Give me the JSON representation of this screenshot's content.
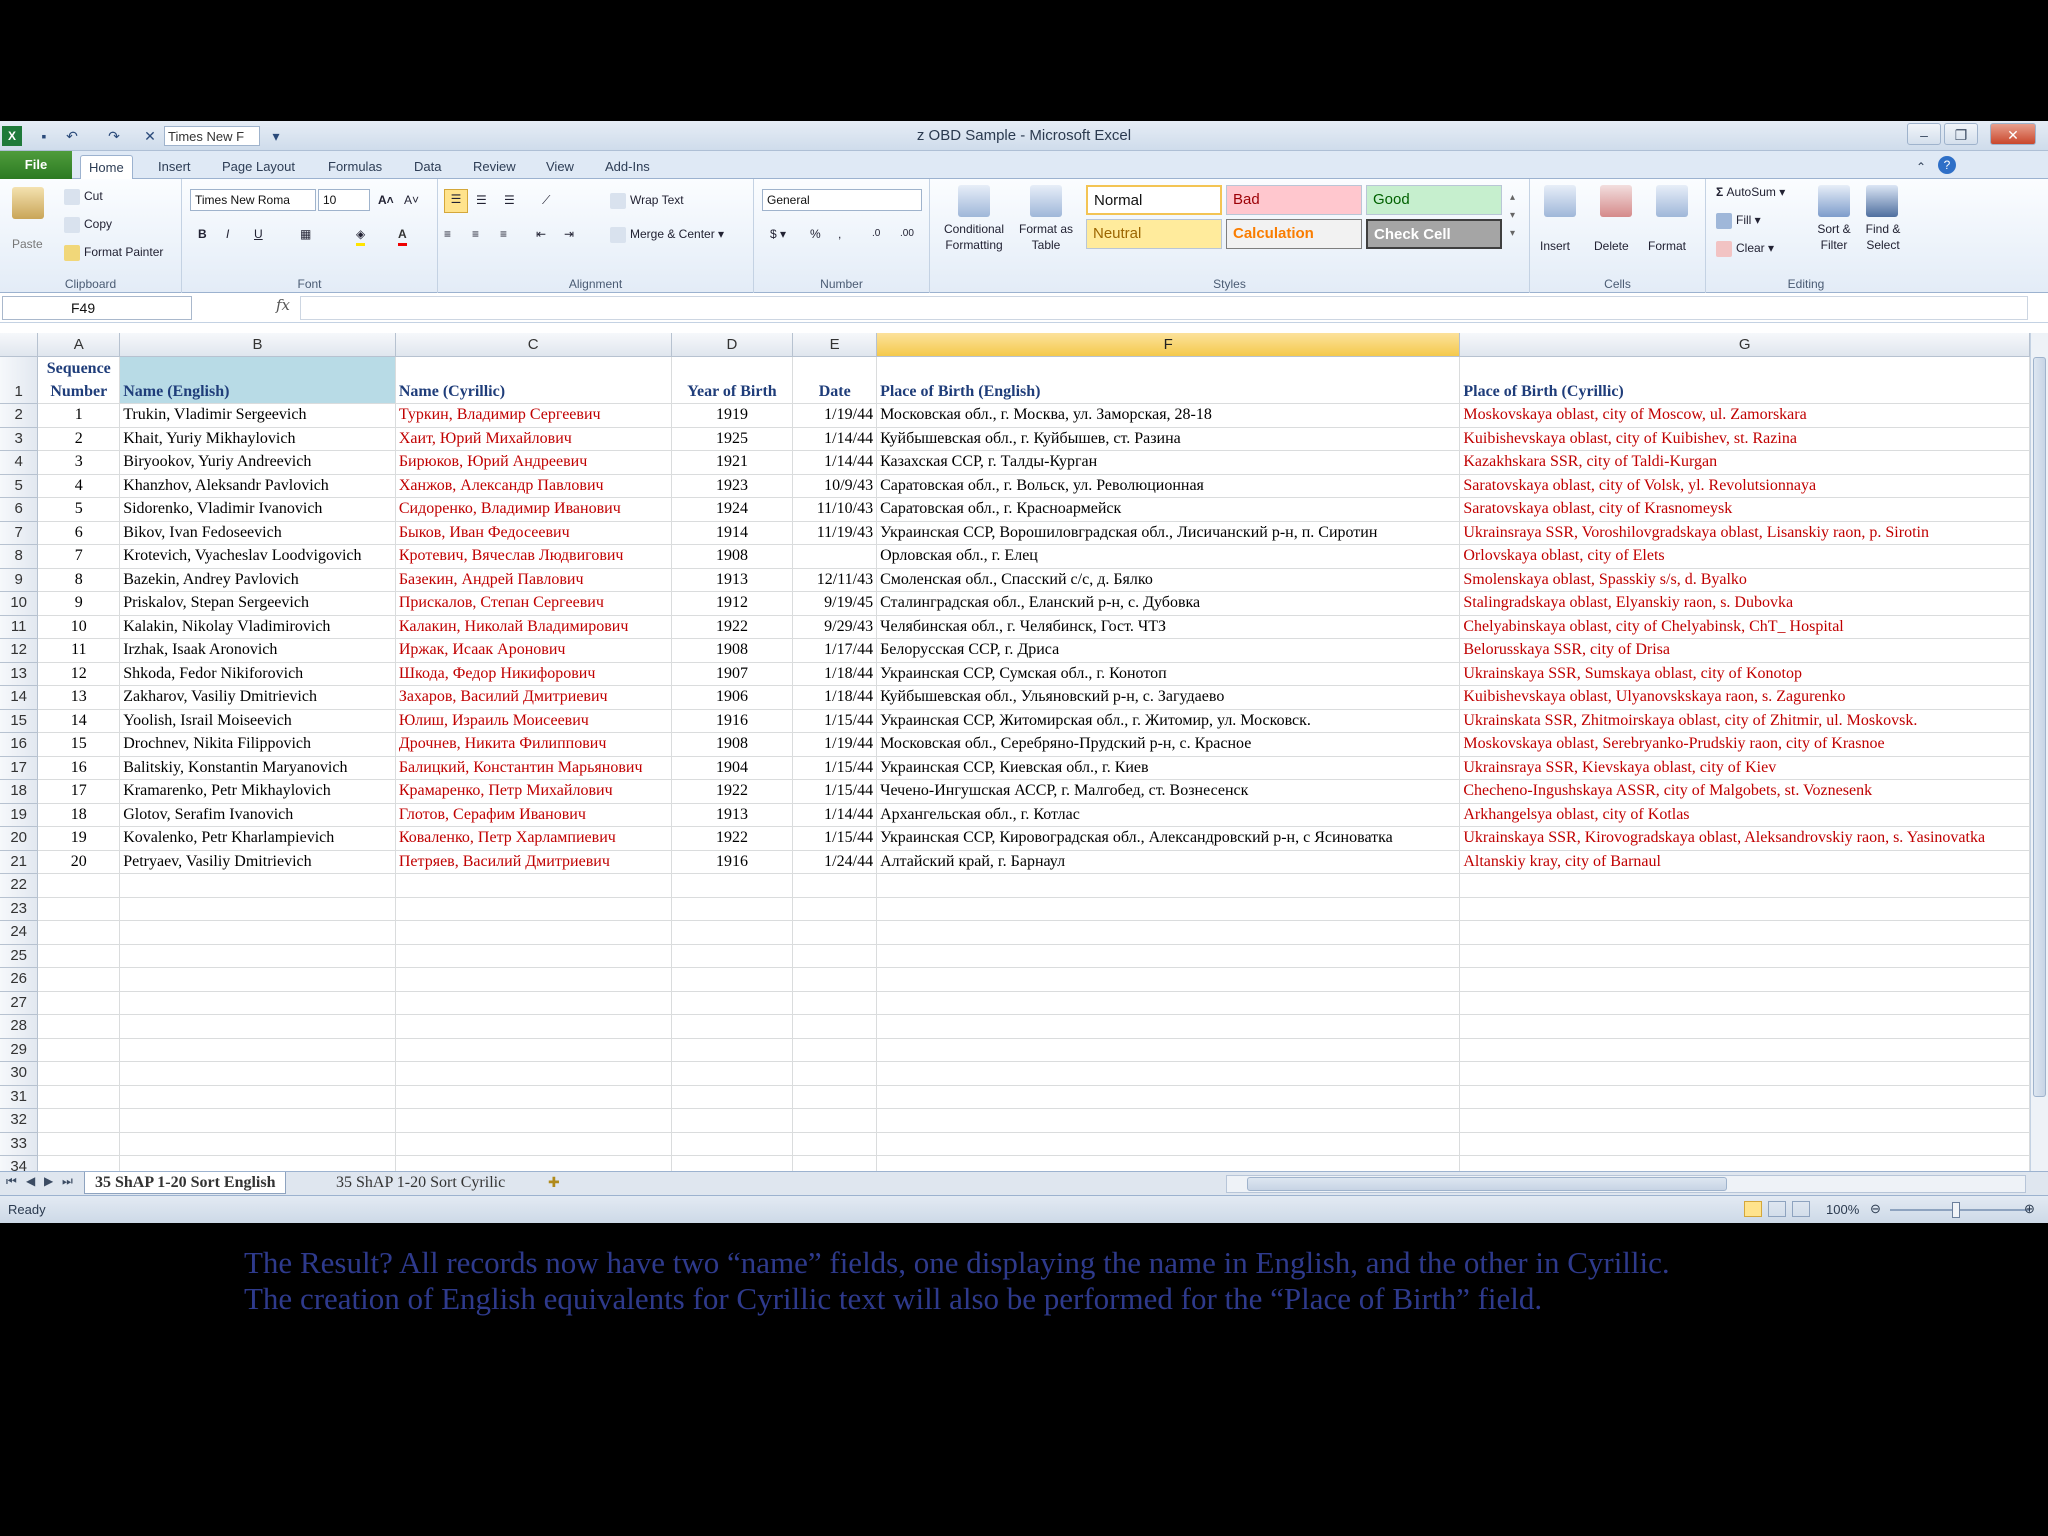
{
  "window": {
    "title": "z OBD Sample - Microsoft Excel",
    "qat_font": "Times New F"
  },
  "ribbon": {
    "tabs": [
      "File",
      "Home",
      "Insert",
      "Page Layout",
      "Formulas",
      "Data",
      "Review",
      "View",
      "Add-Ins"
    ],
    "clipboard": {
      "paste": "Paste",
      "cut": "Cut",
      "copy": "Copy",
      "format_painter": "Format Painter",
      "label": "Clipboard"
    },
    "font": {
      "name": "Times New Roma",
      "size": "10",
      "label": "Font"
    },
    "alignment": {
      "wrap": "Wrap Text",
      "merge": "Merge & Center",
      "label": "Alignment"
    },
    "number": {
      "format": "General",
      "label": "Number"
    },
    "styles": {
      "conditional": "Conditional Formatting",
      "format_table": "Format as Table",
      "normal": "Normal",
      "bad": "Bad",
      "good": "Good",
      "neutral": "Neutral",
      "calculation": "Calculation",
      "check_cell": "Check Cell",
      "label": "Styles"
    },
    "cells": {
      "insert": "Insert",
      "delete": "Delete",
      "format": "Format",
      "label": "Cells"
    },
    "editing": {
      "autosum": "AutoSum",
      "fill": "Fill",
      "clear": "Clear",
      "sort": "Sort & Filter",
      "find": "Find & Select",
      "label": "Editing"
    }
  },
  "formula_bar": {
    "name_box": "F49",
    "fx": "fx",
    "value": ""
  },
  "columns": [
    "A",
    "B",
    "C",
    "D",
    "E",
    "F",
    "G"
  ],
  "header_row": {
    "a1_top": "Sequence",
    "a1_bottom": "Number",
    "b": "Name (English)",
    "c": "Name (Cyrillic)",
    "d": "Year of Birth",
    "e": "Date",
    "f": "Place of Birth (English)",
    "g": "Place of Birth (Cyrillic)"
  },
  "rows": [
    [
      "1",
      "Trukin, Vladimir Sergeevich",
      "Туркин, Владимир Сергеевич",
      "1919",
      "1/19/44",
      "Московская обл., г. Москва, ул. Заморская, 28-18",
      "Moskovskaya oblast, city of Moscow, ul. Zamorskara"
    ],
    [
      "2",
      "Khait, Yuriy Mikhaylovich",
      "Хаит, Юрий Михайлович",
      "1925",
      "1/14/44",
      "Куйбышевская обл., г. Куйбышев, ст. Разина",
      "Kuibishevskaya oblast, city of Kuibishev, st. Razina"
    ],
    [
      "3",
      "Biryookov, Yuriy Andreevich",
      "Бирюков, Юрий Андреевич",
      "1921",
      "1/14/44",
      "Казахская ССР, г. Талды-Курган",
      "Kazakhskara SSR, city of Taldi-Kurgan"
    ],
    [
      "4",
      "Khanzhov, Aleksandr Pavlovich",
      "Ханжов, Александр Павлович",
      "1923",
      "10/9/43",
      "Саратовская обл., г. Вольск, ул. Революционная",
      "Saratovskaya oblast, city of Volsk, yl. Revolutsionnaya"
    ],
    [
      "5",
      "Sidorenko, Vladimir Ivanovich",
      "Сидоренко, Владимир Иванович",
      "1924",
      "11/10/43",
      "Саратовская обл., г. Красноармейск",
      "Saratovskaya oblast, city of Krasnomeysk"
    ],
    [
      "6",
      "Bikov, Ivan Fedoseevich",
      "Быков, Иван Федосеевич",
      "1914",
      "11/19/43",
      "Украинская ССР, Ворошиловградская обл., Лисичанский р-н, п. Сиротин",
      "Ukrainsraya SSR, Voroshilovgradskaya oblast, Lisanskiy raon, p. Sirotin"
    ],
    [
      "7",
      "Krotevich, Vyacheslav Loodvigovich",
      "Кротевич, Вячеслав Людвигович",
      "1908",
      "",
      "Орловская обл., г. Елец",
      "Orlovskaya oblast, city of Elets"
    ],
    [
      "8",
      "Bazekin, Andrey Pavlovich",
      "Базекин, Андрей Павлович",
      "1913",
      "12/11/43",
      "Смоленская обл., Спасский с/с, д. Бялко",
      "Smolenskaya oblast, Spasskiy s/s, d. Byalko"
    ],
    [
      "9",
      "Priskalov, Stepan Sergeevich",
      "Прискалов, Степан Сергеевич",
      "1912",
      "9/19/45",
      "Сталинградская обл., Еланский р-н, с. Дубовка",
      "Stalingradskaya oblast, Elyanskiy raon, s. Dubovka"
    ],
    [
      "10",
      "Kalakin, Nikolay Vladimirovich",
      "Калакин, Николай Владимирович",
      "1922",
      "9/29/43",
      "Челябинская обл., г. Челябинск, Гост. ЧТЗ",
      "Chelyabinskaya oblast, city of Chelyabinsk, ChT_ Hospital"
    ],
    [
      "11",
      "Irzhak, Isaak Aronovich",
      "Иржак, Исаак Аронович",
      "1908",
      "1/17/44",
      "Белорусская ССР, г. Дриса",
      "Belorusskaya SSR, city of Drisa"
    ],
    [
      "12",
      "Shkoda, Fedor Nikiforovich",
      "Шкода, Федор Никифорович",
      "1907",
      "1/18/44",
      "Украинская ССР, Сумская обл., г. Конотоп",
      "Ukrainskaya SSR, Sumskaya oblast, city of Konotop"
    ],
    [
      "13",
      "Zakharov, Vasiliy Dmitrievich",
      "Захаров, Василий Дмитриевич",
      "1906",
      "1/18/44",
      "Куйбышевская обл., Ульяновский р-н, с. Загудаево",
      "Kuibishevskaya oblast, Ulyanovskskaya raon, s. Zagurenko"
    ],
    [
      "14",
      "Yoolish, Israil Moiseevich",
      "Юлиш, Израиль Моисеевич",
      "1916",
      "1/15/44",
      "Украинская ССР, Житомирская обл., г. Житомир, ул. Московск.",
      "Ukrainskata SSR, Zhitmoirskaya oblast, city of Zhitmir, ul. Moskovsk."
    ],
    [
      "15",
      "Drochnev, Nikita Filippovich",
      "Дрочнев, Никита Филиппович",
      "1908",
      "1/19/44",
      "Московская обл., Серебряно-Прудский р-н, с. Красное",
      "Moskovskaya oblast, Serebryanko-Prudskiy raon, city of Krasnoe"
    ],
    [
      "16",
      "Balitskiy, Konstantin Maryanovich",
      "Балицкий, Константин Марьянович",
      "1904",
      "1/15/44",
      "Украинская ССР, Киевская обл., г. Киев",
      "Ukrainsraya SSR, Kievskaya oblast, city of Kiev"
    ],
    [
      "17",
      "Kramarenko, Petr Mikhaylovich",
      "Крамаренко, Петр Михайлович",
      "1922",
      "1/15/44",
      "Чечено-Ингушская АССР, г. Малгобед, ст. Вознесенск",
      "Checheno-Ingushskaya ASSR, city of Malgobets, st. Voznesenk"
    ],
    [
      "18",
      "Glotov, Serafim Ivanovich",
      "Глотов, Серафим Иванович",
      "1913",
      "1/14/44",
      "Архангельская обл., г. Котлас",
      "Arkhangelsya oblast, city of Kotlas"
    ],
    [
      "19",
      "Kovalenko, Petr Kharlampievich",
      "Коваленко, Петр Харлампиевич",
      "1922",
      "1/15/44",
      "Украинская ССР, Кировоградская обл., Александровский р-н, с Ясиноватка",
      "Ukrainskaya SSR, Kirovogradskaya oblast, Aleksandrovskiy raon, s. Yasinovatka"
    ],
    [
      "20",
      "Petryaev, Vasiliy Dmitrievich",
      "Петряев, Василий Дмитриевич",
      "1916",
      "1/24/44",
      "Алтайский край, г. Барнаул",
      "Altanskiy kray, city of Barnaul"
    ]
  ],
  "sheet_tabs": [
    "35 ShAP 1-20 Sort English",
    "35 ShAP 1-20 Sort Cyrilic"
  ],
  "status": {
    "ready": "Ready",
    "zoom": "100%"
  },
  "caption": {
    "line1": "The Result?  All records now have two “name” fields, one displaying the name in English, and the other in Cyrillic.",
    "line2": "The creation of English equivalents for Cyrillic text will also be performed for the “Place of Birth” field."
  }
}
